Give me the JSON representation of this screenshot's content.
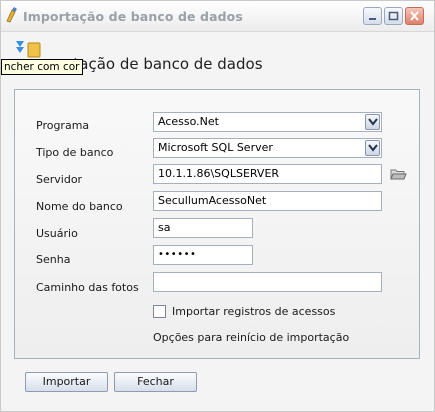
{
  "window": {
    "title": "Importação de banco de dados"
  },
  "tooltip": "ncher com cor",
  "heading": "nportação de banco de dados",
  "form": {
    "programa": {
      "label": "Programa",
      "value": "Acesso.Net"
    },
    "tipo_banco": {
      "label": "Tipo de banco",
      "value": "Microsoft SQL Server"
    },
    "servidor": {
      "label": "Servidor",
      "value": "10.1.1.86\\SQLSERVER"
    },
    "nome_banco": {
      "label": "Nome do banco",
      "value": "SecullumAcessoNet"
    },
    "usuario": {
      "label": "Usuário",
      "value": "sa"
    },
    "senha": {
      "label": "Senha",
      "value": "••••••"
    },
    "caminho_fotos": {
      "label": "Caminho das fotos",
      "value": ""
    }
  },
  "import_records": {
    "label": "Importar registros de acessos",
    "checked": false
  },
  "restart_options": "Opções para reinício de importação",
  "buttons": {
    "import": "Importar",
    "close": "Fechar"
  },
  "icons": [
    "app-icon",
    "minimize-icon",
    "maximize-icon",
    "close-icon",
    "database-import-icon",
    "folder-open-icon",
    "chevron-down-icon"
  ]
}
